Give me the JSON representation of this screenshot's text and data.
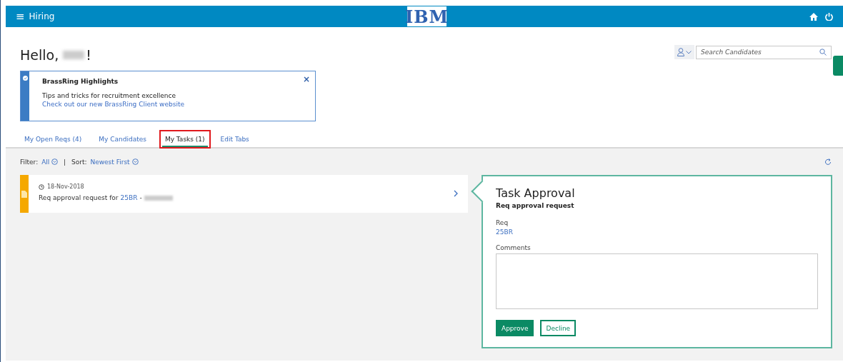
{
  "header": {
    "menu_icon": "≡",
    "title": "Hiring",
    "logo": "IBM"
  },
  "greeting": {
    "prefix": "Hello,",
    "suffix": "!"
  },
  "search": {
    "placeholder": "Search Candidates"
  },
  "highlights": {
    "title": "BrassRing Highlights",
    "text": "Tips and tricks for recruitment excellence",
    "link": "Check out our new BrassRing Client website",
    "close": "×"
  },
  "tabs": [
    {
      "label": "My Open Reqs (4)",
      "selected": false,
      "highlighted": false
    },
    {
      "label": "My Candidates",
      "selected": false,
      "highlighted": false
    },
    {
      "label": "My Tasks (1)",
      "selected": true,
      "highlighted": true
    },
    {
      "label": "Edit Tabs",
      "selected": false,
      "highlighted": false
    }
  ],
  "filter": {
    "label": "Filter:",
    "value": "All",
    "separator": "|",
    "sort_label": "Sort:",
    "sort_value": "Newest First"
  },
  "tasks": [
    {
      "date": "18-Nov-2018",
      "text": "Req approval request for",
      "req": "25BR",
      "dash": "-",
      "color": "#f5a800"
    }
  ],
  "panel": {
    "title": "Task Approval",
    "subtitle": "Req approval request",
    "req_label": "Req",
    "req_value": "25BR",
    "comments_label": "Comments",
    "buttons": [
      {
        "label": "Approve",
        "kind": "primary"
      },
      {
        "label": "Decline",
        "kind": "secondary"
      }
    ]
  }
}
